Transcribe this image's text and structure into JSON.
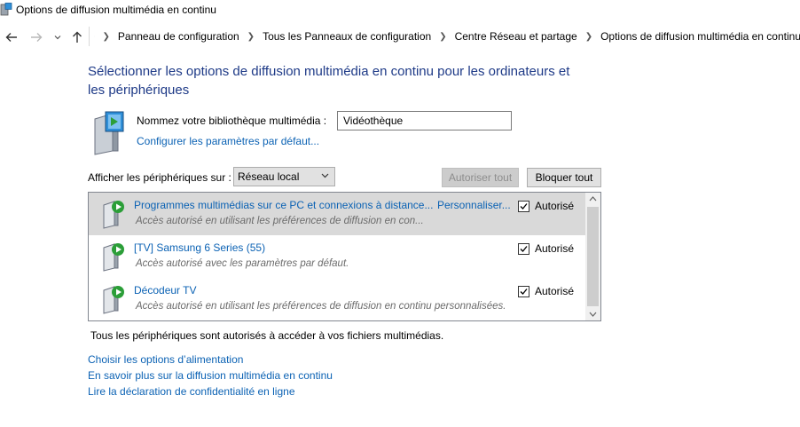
{
  "window": {
    "title": "Options de diffusion multimédia en continu"
  },
  "nav": {
    "breadcrumbs": [
      "Panneau de configuration",
      "Tous les Panneaux de configuration",
      "Centre Réseau et partage",
      "Options de diffusion multimédia en continu"
    ]
  },
  "main": {
    "heading_line1": "Sélectionner les options de diffusion multimédia en continu pour les ordinateurs et",
    "heading_line2": "les périphériques",
    "library_label": "Nommez votre bibliothèque multimédia :",
    "library_value": "Vidéothèque",
    "configure_link": "Configurer les paramètres par défaut...",
    "show_devices_label": "Afficher les périphériques sur :",
    "network_select": "Réseau local",
    "allow_all_label": "Autoriser tout",
    "block_all_label": "Bloquer tout",
    "devices": [
      {
        "name": "Programmes multimédias sur ce PC et connexions à distance...",
        "description": "Accès autorisé en utilisant les préférences de diffusion en con...",
        "customize": "Personnaliser...",
        "status": "Autorisé",
        "checked": true
      },
      {
        "name": "[TV] Samsung 6 Series (55)",
        "description": "Accès autorisé avec les paramètres par défaut.",
        "status": "Autorisé",
        "checked": true
      },
      {
        "name": "Décodeur TV",
        "description": "Accès autorisé en utilisant les préférences de diffusion en continu personnalisées.",
        "status": "Autorisé",
        "checked": true
      }
    ],
    "status_text": "Tous les périphériques sont autorisés à accéder à vos fichiers multimédias."
  },
  "links": [
    "Choisir les options d’alimentation",
    "En savoir plus sur la diffusion multimédia en continu",
    "Lire la déclaration de confidentialité en ligne"
  ],
  "colors": {
    "link": "#0b62b4",
    "heading": "#1e3a87",
    "selected_row": "#d9d9d9"
  },
  "icons": [
    "media-library-icon",
    "back-arrow-icon",
    "forward-arrow-icon",
    "up-arrow-icon",
    "control-panel-icon",
    "device-icon",
    "checkbox-checked-icon"
  ]
}
